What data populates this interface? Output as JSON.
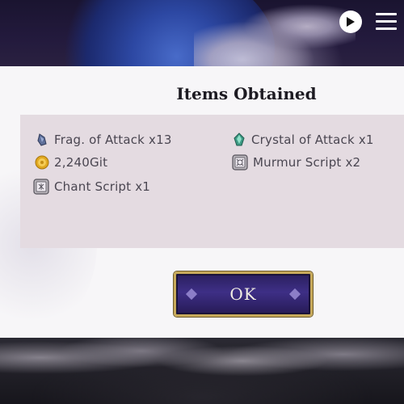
{
  "dialog": {
    "title": "Items Obtained",
    "ok_label": "OK",
    "items": [
      {
        "icon": "attack-fragment-icon",
        "label": "Frag. of Attack x13"
      },
      {
        "icon": "gold-coin-icon",
        "label": "2,240Git"
      },
      {
        "icon": "chant-script-icon",
        "label": "Chant Script  x1"
      },
      {
        "icon": "attack-crystal-icon",
        "label": "Crystal of Attack x1"
      },
      {
        "icon": "murmur-script-icon",
        "label": "Murmur Script x2"
      }
    ]
  },
  "hud": {
    "play_icon": "play-icon",
    "menu_icon": "hamburger-menu-icon"
  },
  "colors": {
    "panel_bg": "#f7f6f8",
    "items_box_bg": "#e4dbe1",
    "ok_button_bg": "#3e2f86",
    "ok_button_border": "#c7a95a",
    "text": "#4a4651"
  }
}
